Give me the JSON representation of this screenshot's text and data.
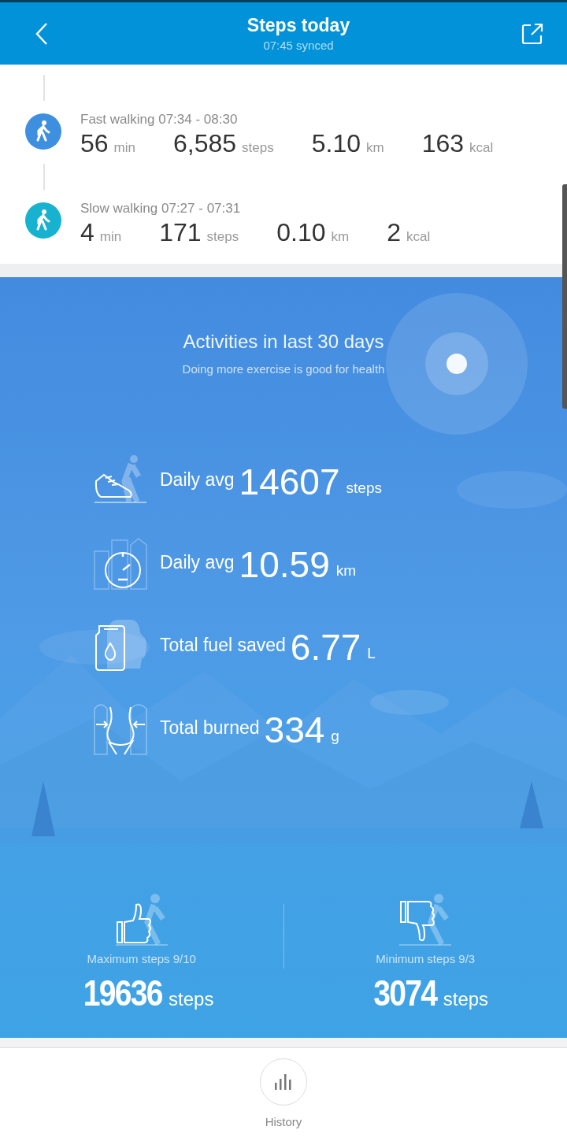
{
  "header": {
    "title": "Steps today",
    "subtitle": "07:45 synced"
  },
  "activities": [
    {
      "title": "Fast walking 07:34 - 08:30",
      "color": "#3f8fe0",
      "values": [
        {
          "value": "56",
          "unit": "min"
        },
        {
          "value": "6,585",
          "unit": "steps"
        },
        {
          "value": "5.10",
          "unit": "km"
        },
        {
          "value": "163",
          "unit": "kcal"
        }
      ]
    },
    {
      "title": "Slow walking 07:27 - 07:31",
      "color": "#17b2cf",
      "values": [
        {
          "value": "4",
          "unit": "min"
        },
        {
          "value": "171",
          "unit": "steps"
        },
        {
          "value": "0.10",
          "unit": "km"
        },
        {
          "value": "2",
          "unit": "kcal"
        }
      ]
    }
  ],
  "summary": {
    "title": "Activities in last 30 days",
    "subtitle": "Doing more exercise is good for health",
    "stats": [
      {
        "kind": "steps",
        "label": "Daily avg",
        "value": "14607",
        "unit": "steps"
      },
      {
        "kind": "distance",
        "label": "Daily avg",
        "value": "10.59",
        "unit": "km"
      },
      {
        "kind": "fuel",
        "label": "Total fuel saved",
        "value": "6.77",
        "unit": "L"
      },
      {
        "kind": "weight",
        "label": "Total burned",
        "value": "334",
        "unit": "g"
      }
    ],
    "records": [
      {
        "kind": "max",
        "label": "Maximum steps 9/10",
        "value": "19636",
        "unit": "steps"
      },
      {
        "kind": "min",
        "label": "Minimum steps 9/3",
        "value": "3074",
        "unit": "steps"
      }
    ]
  },
  "footer": {
    "label": "History"
  }
}
